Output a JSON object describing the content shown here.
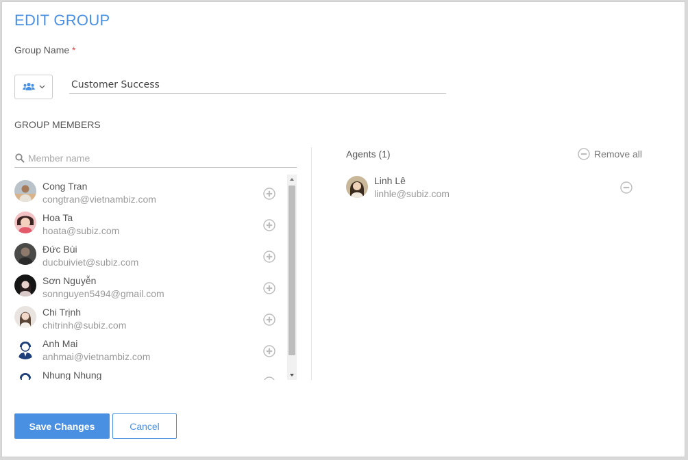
{
  "title": "EDIT GROUP",
  "group_name": {
    "label": "Group Name",
    "required_mark": "*",
    "value": "Customer Success",
    "icon": "users-icon"
  },
  "members_section": {
    "label": "GROUP MEMBERS",
    "search_placeholder": "Member name",
    "members": [
      {
        "name": "Cong Tran",
        "email": "congtran@vietnambiz.com"
      },
      {
        "name": "Hoa Ta",
        "email": "hoata@subiz.com"
      },
      {
        "name": "Đức Bùi",
        "email": "ducbuiviet@subiz.com"
      },
      {
        "name": "Sơn Nguyễn",
        "email": "sonnguyen5494@gmail.com"
      },
      {
        "name": "Chi Trịnh",
        "email": "chitrinh@subiz.com"
      },
      {
        "name": "Anh Mai",
        "email": "anhmai@vietnambiz.com"
      },
      {
        "name": "Nhung Nhung",
        "email": ""
      }
    ]
  },
  "agents_section": {
    "count_label": "Agents (1)",
    "remove_all_label": "Remove all",
    "agents": [
      {
        "name": "Linh Lê",
        "email": "linhle@subiz.com"
      }
    ]
  },
  "buttons": {
    "save": "Save Changes",
    "cancel": "Cancel"
  },
  "colors": {
    "accent": "#4a90e2",
    "required": "#e04b4b"
  }
}
